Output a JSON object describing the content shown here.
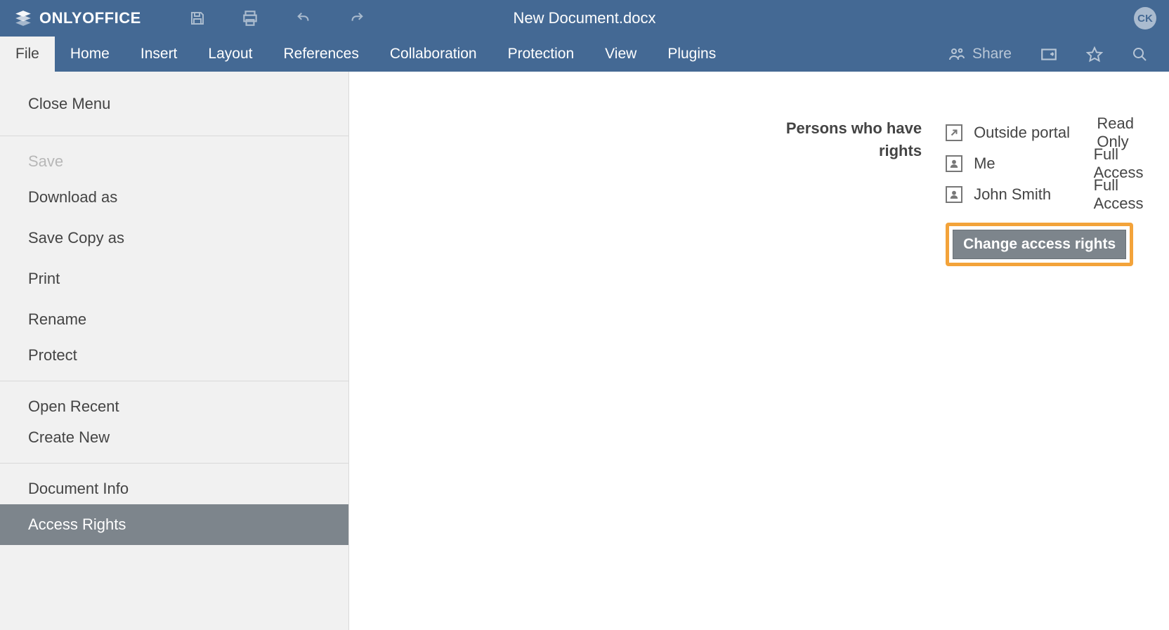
{
  "brand": "ONLYOFFICE",
  "document_title": "New Document.docx",
  "avatar_initials": "CK",
  "tabs": {
    "file": "File",
    "home": "Home",
    "insert": "Insert",
    "layout": "Layout",
    "references": "References",
    "collaboration": "Collaboration",
    "protection": "Protection",
    "view": "View",
    "plugins": "Plugins"
  },
  "share_label": "Share",
  "file_menu": {
    "close_menu": "Close Menu",
    "save": "Save",
    "download_as": "Download as",
    "save_copy_as": "Save Copy as",
    "print": "Print",
    "rename": "Rename",
    "protect": "Protect",
    "open_recent": "Open Recent",
    "create_new": "Create New",
    "document_info": "Document Info",
    "access_rights": "Access Rights"
  },
  "rights": {
    "heading_line1": "Persons who have",
    "heading_line2": "rights",
    "people": [
      {
        "icon": "external",
        "name": "Outside portal",
        "permission": "Read Only"
      },
      {
        "icon": "person",
        "name": "Me",
        "permission": "Full Access"
      },
      {
        "icon": "person",
        "name": "John Smith",
        "permission": "Full Access"
      }
    ],
    "change_button": "Change access rights"
  }
}
